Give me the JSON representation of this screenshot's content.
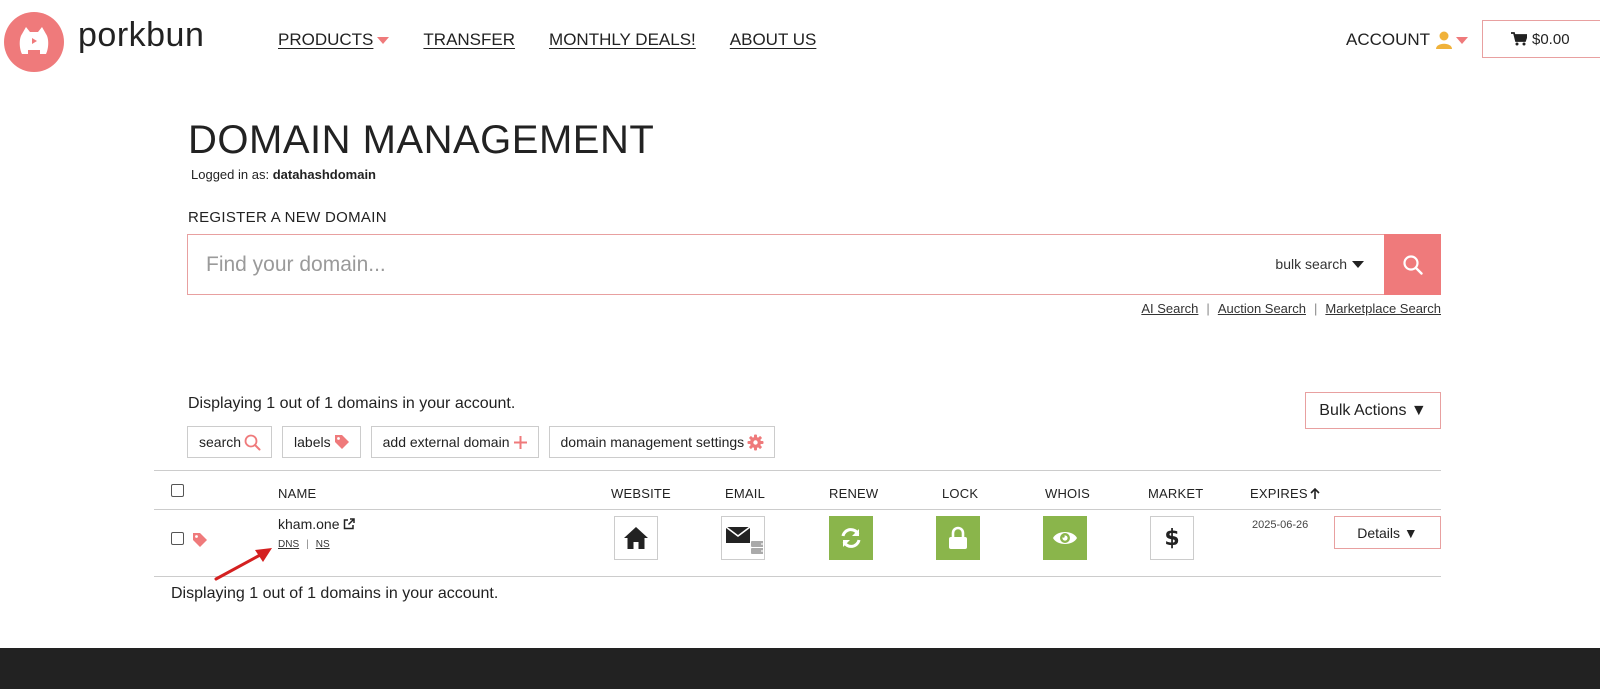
{
  "brand": {
    "name": "porkbun",
    "color": "#ef7a7b"
  },
  "nav": {
    "items": [
      {
        "label": "PRODUCTS",
        "has_dropdown": true
      },
      {
        "label": "TRANSFER",
        "has_dropdown": false
      },
      {
        "label": "MONTHLY DEALS!",
        "has_dropdown": false
      },
      {
        "label": "ABOUT US",
        "has_dropdown": false
      }
    ],
    "account_label": "ACCOUNT",
    "cart_total": "$0.00"
  },
  "page": {
    "title": "DOMAIN MANAGEMENT",
    "logged_in_prefix": "Logged in as:",
    "username": "datahashdomain"
  },
  "register": {
    "label": "REGISTER A NEW DOMAIN",
    "placeholder": "Find your domain...",
    "bulk_search_label": "bulk search",
    "links": [
      "AI Search",
      "Auction Search",
      "Marketplace Search"
    ]
  },
  "domains": {
    "displaying_text": "Displaying 1 out of 1 domains in your account.",
    "bulk_actions_label": "Bulk Actions ▼",
    "filters": [
      {
        "label": "search",
        "icon": "search-icon"
      },
      {
        "label": "labels",
        "icon": "tag-icon"
      },
      {
        "label": "add external domain",
        "icon": "plus-icon"
      },
      {
        "label": "domain management settings",
        "icon": "gear-icon"
      }
    ],
    "columns": [
      "NAME",
      "WEBSITE",
      "EMAIL",
      "RENEW",
      "LOCK",
      "WHOIS",
      "MARKET",
      "EXPIRES"
    ],
    "rows": [
      {
        "name": "kham.one",
        "dns_label": "DNS",
        "ns_label": "NS",
        "expires": "2025-06-26",
        "details_label": "Details ▼"
      }
    ]
  },
  "colors": {
    "accent": "#ef7a7b",
    "green": "#8ab54b",
    "footer": "#222222",
    "annotation": "#d42020"
  }
}
